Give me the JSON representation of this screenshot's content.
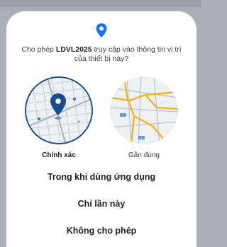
{
  "dialog": {
    "icon": "location-pin-icon",
    "title_prefix": "Cho phép ",
    "app_name": "LDVL2025",
    "title_suffix": " truy cập vào thông tin vị trí của thiết bị này?",
    "precise_label": "Chính xác",
    "approximate_label": "Gần đúng",
    "precise_selected": true,
    "choices": [
      "Trong khi dùng ứng dụng",
      "Chỉ lần này",
      "Không cho phép"
    ]
  },
  "colors": {
    "accent": "#1a73e8",
    "selected_ring": "#1a4b8c",
    "scrim": "#a9b0b6",
    "dialog_bg": "#ffffff",
    "map_bg": "#eef1f4",
    "road_major": "#f0b429"
  }
}
